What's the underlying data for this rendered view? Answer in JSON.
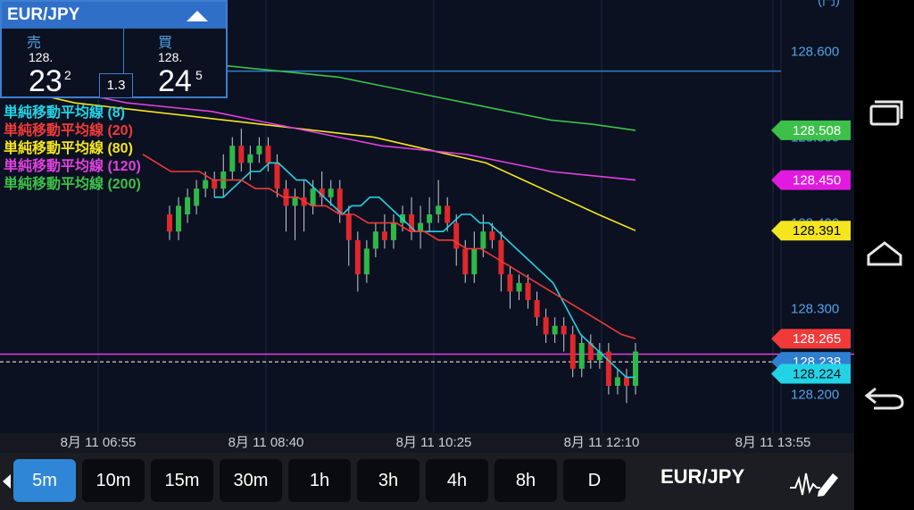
{
  "quote": {
    "symbol": "EUR/JPY",
    "sell_label": "売",
    "buy_label": "買",
    "sell_prefix": "128.",
    "sell_big": "23",
    "sell_sup": "2",
    "buy_prefix": "128.",
    "buy_big": "24",
    "buy_sup": "5",
    "spread": "1.3"
  },
  "legend": [
    {
      "label": "単純移動平均線 (8)",
      "color": "#22d3e6"
    },
    {
      "label": "単純移動平均線 (20)",
      "color": "#f03a3a"
    },
    {
      "label": "単純移動平均線 (80)",
      "color": "#f5e51f"
    },
    {
      "label": "単純移動平均線 (120)",
      "color": "#e040e0"
    },
    {
      "label": "単純移動平均線 (200)",
      "color": "#3dc04a"
    }
  ],
  "price_axis": {
    "labels": [
      "128.600",
      "128.500",
      "128.400",
      "128.300",
      "128.200"
    ],
    "top_partial": "(円)"
  },
  "price_tags": [
    {
      "value": "128.508",
      "color": "#3dc04a",
      "text_color": "#ffffff",
      "y": 128.508
    },
    {
      "value": "128.450",
      "color": "#e21ae0",
      "text_color": "#ffffff",
      "y": 128.45
    },
    {
      "value": "128.391",
      "color": "#f5e51f",
      "text_color": "#000000",
      "y": 128.391
    },
    {
      "value": "128.265",
      "color": "#f03a3a",
      "text_color": "#ffffff",
      "y": 128.265
    },
    {
      "value": "128.238",
      "color": "#2f7fd0",
      "text_color": "#ffffff",
      "y": 128.238
    },
    {
      "value": "128.224",
      "color": "#22d3e6",
      "text_color": "#0b1120",
      "y": 128.224
    }
  ],
  "reference_lines": {
    "blue_level": 128.577,
    "magenta_level": 128.247,
    "current_price": 128.238
  },
  "time_axis": [
    "8月 11 06:55",
    "8月 11 08:40",
    "8月 11 10:25",
    "8月 11 12:10",
    "8月 11 13:55"
  ],
  "timeframes": [
    {
      "label": "5m",
      "active": true
    },
    {
      "label": "10m",
      "active": false
    },
    {
      "label": "15m",
      "active": false
    },
    {
      "label": "30m",
      "active": false
    },
    {
      "label": "1h",
      "active": false
    },
    {
      "label": "3h",
      "active": false
    },
    {
      "label": "4h",
      "active": false
    },
    {
      "label": "8h",
      "active": false
    },
    {
      "label": "D",
      "active": false
    }
  ],
  "bottom_symbol": "EUR/JPY",
  "nav": {
    "icons": [
      "recent-apps-icon",
      "home-icon",
      "back-icon"
    ]
  },
  "chart_data": {
    "type": "candlestick",
    "y_range": [
      128.16,
      128.66
    ],
    "candles": [
      [
        128.41,
        128.39,
        128.42,
        128.38
      ],
      [
        128.39,
        128.42,
        128.43,
        128.38
      ],
      [
        128.41,
        128.43,
        128.44,
        128.4
      ],
      [
        128.42,
        128.44,
        128.45,
        128.41
      ],
      [
        128.44,
        128.45,
        128.46,
        128.43
      ],
      [
        128.45,
        128.44,
        128.46,
        128.43
      ],
      [
        128.44,
        128.46,
        128.48,
        128.43
      ],
      [
        128.46,
        128.49,
        128.5,
        128.45
      ],
      [
        128.49,
        128.47,
        128.51,
        128.46
      ],
      [
        128.47,
        128.48,
        128.49,
        128.45
      ],
      [
        128.48,
        128.49,
        128.5,
        128.47
      ],
      [
        128.49,
        128.47,
        128.5,
        128.46
      ],
      [
        128.47,
        128.44,
        128.48,
        128.43
      ],
      [
        128.44,
        128.42,
        128.45,
        128.39
      ],
      [
        128.42,
        128.43,
        128.44,
        128.38
      ],
      [
        128.43,
        128.42,
        128.45,
        128.39
      ],
      [
        128.42,
        128.44,
        128.45,
        128.41
      ],
      [
        128.44,
        128.43,
        128.46,
        128.42
      ],
      [
        128.43,
        128.44,
        128.45,
        128.42
      ],
      [
        128.44,
        128.41,
        128.45,
        128.4
      ],
      [
        128.41,
        128.38,
        128.42,
        128.35
      ],
      [
        128.38,
        128.34,
        128.39,
        128.32
      ],
      [
        128.34,
        128.37,
        128.38,
        128.33
      ],
      [
        128.37,
        128.39,
        128.4,
        128.36
      ],
      [
        128.39,
        128.38,
        128.41,
        128.37
      ],
      [
        128.38,
        128.4,
        128.41,
        128.37
      ],
      [
        128.4,
        128.41,
        128.42,
        128.39
      ],
      [
        128.41,
        128.39,
        128.43,
        128.38
      ],
      [
        128.39,
        128.4,
        128.42,
        128.37
      ],
      [
        128.4,
        128.41,
        128.43,
        128.39
      ],
      [
        128.41,
        128.42,
        128.45,
        128.4
      ],
      [
        128.42,
        128.4,
        128.43,
        128.39
      ],
      [
        128.4,
        128.37,
        128.41,
        128.35
      ],
      [
        128.37,
        128.34,
        128.38,
        128.33
      ],
      [
        128.34,
        128.37,
        128.39,
        128.33
      ],
      [
        128.37,
        128.39,
        128.41,
        128.36
      ],
      [
        128.39,
        128.38,
        128.4,
        128.37
      ],
      [
        128.38,
        128.34,
        128.39,
        128.32
      ],
      [
        128.34,
        128.32,
        128.35,
        128.3
      ],
      [
        128.32,
        128.33,
        128.34,
        128.31
      ],
      [
        128.33,
        128.31,
        128.34,
        128.3
      ],
      [
        128.31,
        128.29,
        128.32,
        128.28
      ],
      [
        128.29,
        128.27,
        128.3,
        128.26
      ],
      [
        128.27,
        128.28,
        128.29,
        128.26
      ],
      [
        128.28,
        128.27,
        128.29,
        128.25
      ],
      [
        128.27,
        128.23,
        128.28,
        128.22
      ],
      [
        128.23,
        128.26,
        128.27,
        128.22
      ],
      [
        128.26,
        128.24,
        128.27,
        128.23
      ],
      [
        128.24,
        128.25,
        128.26,
        128.23
      ],
      [
        128.25,
        128.21,
        128.26,
        128.2
      ],
      [
        128.21,
        128.22,
        128.23,
        128.2
      ],
      [
        128.22,
        128.21,
        128.23,
        128.19
      ],
      [
        128.21,
        128.25,
        128.26,
        128.2
      ]
    ],
    "ma_lines": [
      {
        "name": "単純移動平均線 (8)",
        "color": "#22d3e6",
        "values": [
          128.43,
          128.43,
          128.44,
          128.45,
          128.46,
          128.46,
          128.47,
          128.47,
          128.46,
          128.45,
          128.45,
          128.44,
          128.43,
          128.42,
          128.41,
          128.42,
          128.42,
          128.43,
          128.43,
          128.42,
          128.41,
          128.4,
          128.39,
          128.39,
          128.39,
          128.39,
          128.4,
          128.41,
          128.41,
          128.4,
          128.4,
          128.39,
          128.38,
          128.37,
          128.36,
          128.35,
          128.34,
          128.33,
          128.31,
          128.29,
          128.27,
          128.26,
          128.25,
          128.24,
          128.23,
          128.22,
          128.22
        ]
      },
      {
        "name": "単純移動平均線 (20)",
        "color": "#f03a3a",
        "values": [
          128.48,
          128.47,
          128.46,
          128.46,
          128.46,
          128.45,
          128.45,
          128.45,
          128.44,
          128.44,
          128.43,
          128.43,
          128.42,
          128.42,
          128.41,
          128.41,
          128.4,
          128.4,
          128.4,
          128.39,
          128.39,
          128.38,
          128.38,
          128.37,
          128.37,
          128.36,
          128.35,
          128.34,
          128.33,
          128.32,
          128.31,
          128.3,
          128.29,
          128.28,
          128.27,
          128.265
        ]
      },
      {
        "name": "単純移動平均線 (80)",
        "color": "#f5e51f",
        "values": [
          128.56,
          128.55,
          128.54,
          128.535,
          128.53,
          128.525,
          128.52,
          128.515,
          128.51,
          128.505,
          128.5,
          128.49,
          128.48,
          128.47,
          128.45,
          128.43,
          128.41,
          128.391
        ]
      },
      {
        "name": "単純移動平均線 (120)",
        "color": "#e040e0",
        "values": [
          128.57,
          128.56,
          128.55,
          128.54,
          128.535,
          128.53,
          128.52,
          128.51,
          128.5,
          128.49,
          128.485,
          128.48,
          128.47,
          128.46,
          128.455,
          128.45
        ]
      },
      {
        "name": "単純移動平均線 (200)",
        "color": "#3dc04a",
        "values": [
          128.61,
          128.605,
          128.6,
          128.595,
          128.59,
          128.585,
          128.58,
          128.575,
          128.57,
          128.56,
          128.55,
          128.54,
          128.53,
          128.52,
          128.515,
          128.508
        ]
      }
    ]
  }
}
